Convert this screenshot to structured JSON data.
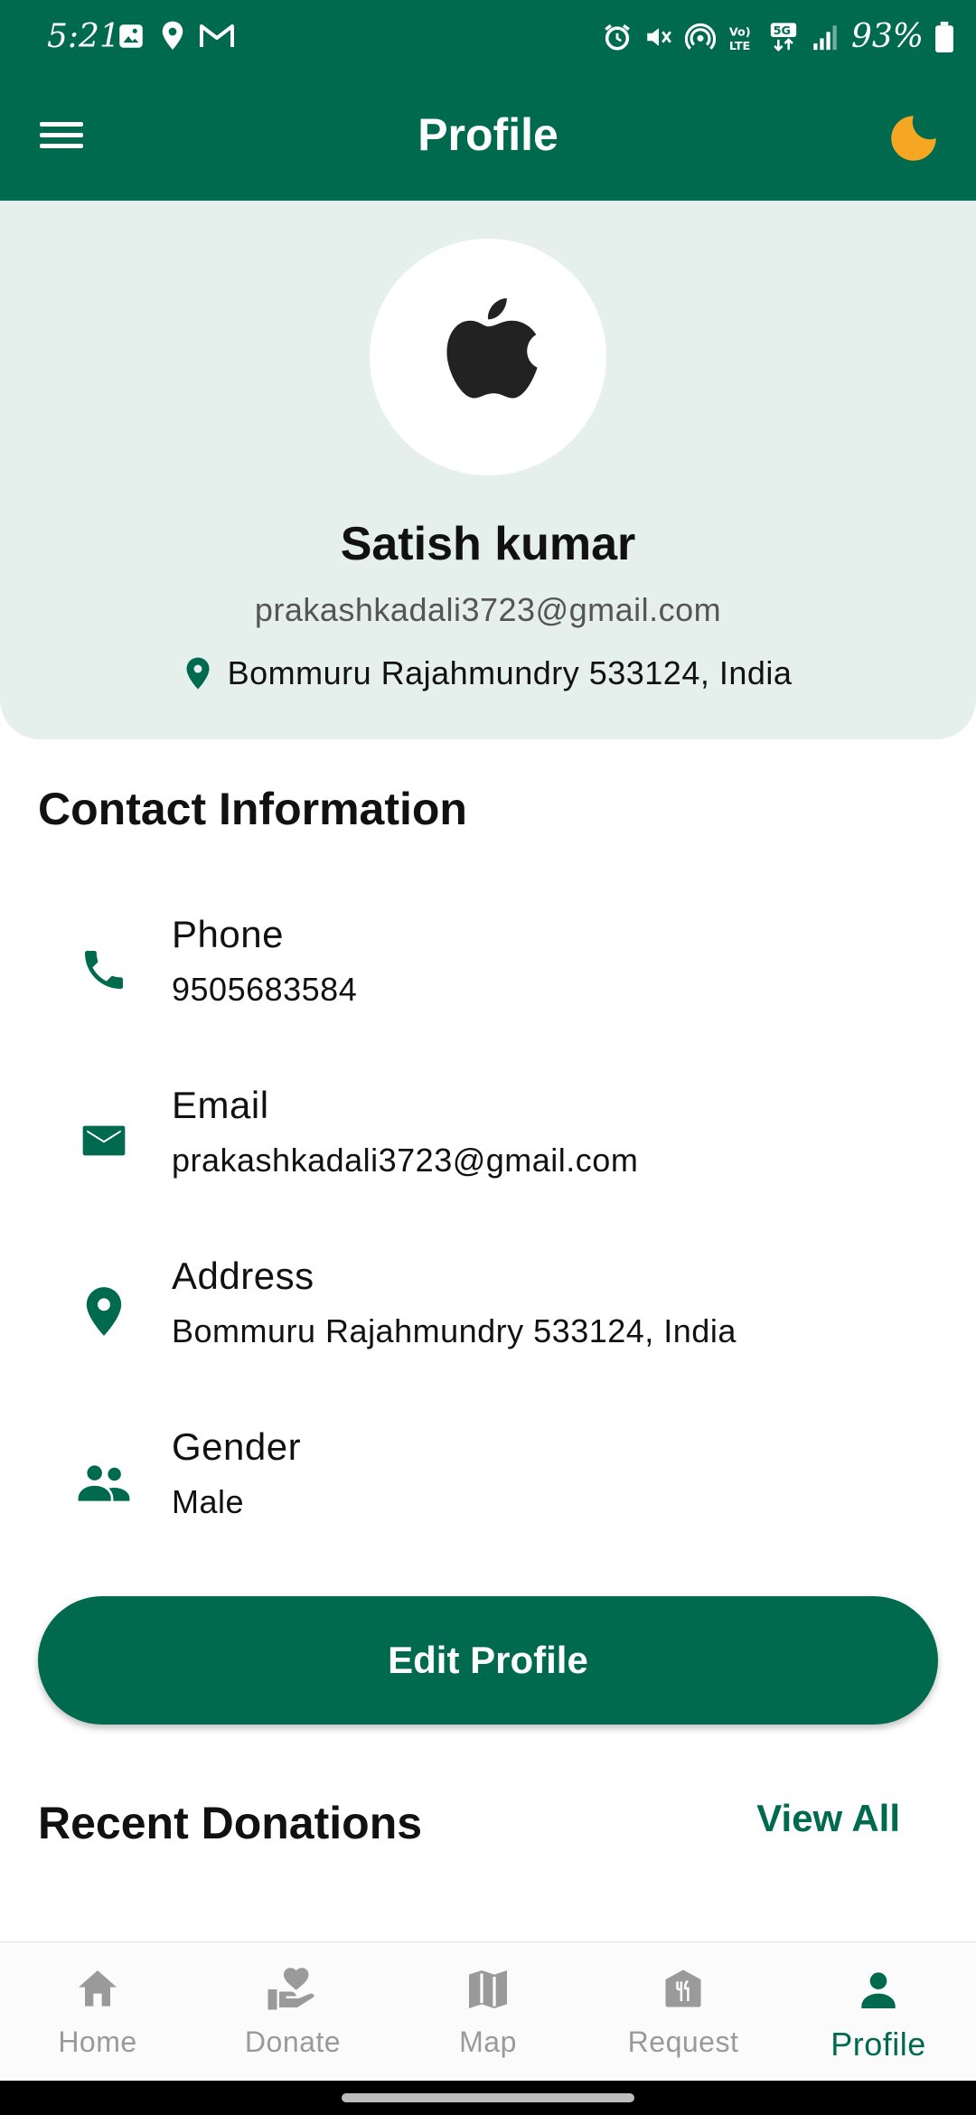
{
  "status_bar": {
    "time": "5:21",
    "battery": "93%"
  },
  "app_bar": {
    "title": "Profile"
  },
  "profile": {
    "name": "Satish kumar",
    "email": "prakashkadali3723@gmail.com",
    "location": "Bommuru Rajahmundry 533124, India"
  },
  "contact_section": {
    "title": "Contact Information",
    "items": [
      {
        "label": "Phone",
        "value": "9505683584",
        "icon": "phone-icon"
      },
      {
        "label": "Email",
        "value": "prakashkadali3723@gmail.com",
        "icon": "email-icon"
      },
      {
        "label": "Address",
        "value": "Bommuru Rajahmundry 533124, India",
        "icon": "location-icon"
      },
      {
        "label": "Gender",
        "value": "Male",
        "icon": "people-icon"
      }
    ]
  },
  "edit_button": {
    "label": "Edit Profile"
  },
  "recent_donations": {
    "title": "Recent Donations",
    "view_all": "View All"
  },
  "bottom_nav": {
    "items": [
      {
        "label": "Home",
        "icon": "home-icon"
      },
      {
        "label": "Donate",
        "icon": "donate-icon"
      },
      {
        "label": "Map",
        "icon": "map-icon"
      },
      {
        "label": "Request",
        "icon": "request-icon"
      },
      {
        "label": "Profile",
        "icon": "person-icon",
        "active": true
      }
    ]
  },
  "colors": {
    "primary": "#006a4e",
    "header_bg": "#e5efeb",
    "accent_moon": "#f5a623",
    "inactive": "#9a9a9a"
  }
}
